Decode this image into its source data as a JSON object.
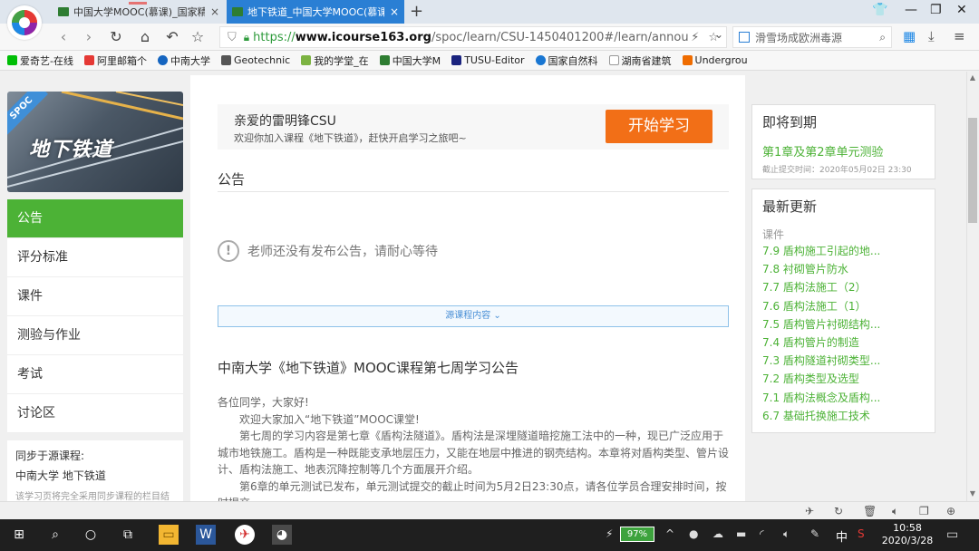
{
  "browser": {
    "tabs": [
      {
        "title": "中国大学MOOC(慕课)_国家精品",
        "close": "×"
      },
      {
        "title": "地下铁道_中国大学MOOC(慕课",
        "close": "×"
      }
    ],
    "new_tab": "+",
    "url": {
      "scheme": "https://",
      "host": "www.icourse163.org",
      "path": "/spoc/learn/CSU-1450401200#/learn/annou"
    },
    "search_placeholder": "滑雪场成欧洲毒源",
    "bookmarks": [
      "爱奇艺-在线",
      "阿里邮箱个",
      "中南大学",
      "Geotechnic",
      "我的学堂_在",
      "中国大学M",
      "TUSU-Editor",
      "国家自然科",
      "湖南省建筑",
      "Undergrou"
    ],
    "colors": {
      "active_tab": "#2a7fd4",
      "https_green": "#2e9b3c"
    }
  },
  "sidebar": {
    "cover_badge": "SPOC",
    "cover_title": "地下铁道",
    "menu": [
      "公告",
      "评分标准",
      "课件",
      "测验与作业",
      "考试",
      "讨论区"
    ],
    "active_index": 0,
    "sync": {
      "line1": "同步于源课程:",
      "line2": "中南大学 地下铁道",
      "line3": "该学习页将完全采用同步课程的栏目结"
    }
  },
  "main": {
    "greeting": "亲爱的雷明锋CSU",
    "welcome": "欢迎你加入课程《地下铁道》，赶快开启学习之旅吧~",
    "start_button": "开始学习",
    "section_title": "公告",
    "no_notice": "老师还没有发布公告，请耐心等待",
    "source_button": "源课程内容",
    "notice_title": "中南大学《地下铁道》MOOC课程第七周学习公告",
    "notice_body": [
      "各位同学，大家好!",
      "欢迎大家加入“地下铁道”MOOC课堂!",
      "第七周的学习内容是第七章《盾构法隧道》。盾构法是深埋隧道暗挖施工法中的一种，现已广泛应用于城市地铁施工。盾构是一种既能支承地层压力，又能在地层中推进的钢壳结构。本章将对盾构类型、管片设计、盾构法施工、地表沉降控制等几个方面展开介绍。",
      "第6章的单元测试已发布，单元测试提交的截止时间为5月2日23:30点，请各位学员合理安排时间，按时提交。"
    ],
    "colors": {
      "start_button": "#f26f17",
      "active_green": "#4cb236"
    }
  },
  "right": {
    "upcoming": {
      "title": "即将到期",
      "item": "第1章及第2章单元测验",
      "deadline": "截止提交时间：2020年05月02日 23:30"
    },
    "updates": {
      "title": "最新更新",
      "category": "课件",
      "items": [
        "7.9 盾构施工引起的地...",
        "7.8 衬砌管片防水",
        "7.7 盾构法施工（2）",
        "7.6 盾构法施工（1）",
        "7.5 盾构管片衬砌结构...",
        "7.4 盾构管片的制造",
        "7.3 盾构隧道衬砌类型...",
        "7.2 盾构类型及选型",
        "7.1 盾构法概念及盾构...",
        "6.7 基础托换施工技术"
      ]
    }
  },
  "taskbar": {
    "battery": "97%",
    "ime": "中",
    "time": "10:58",
    "date": "2020/3/28"
  }
}
